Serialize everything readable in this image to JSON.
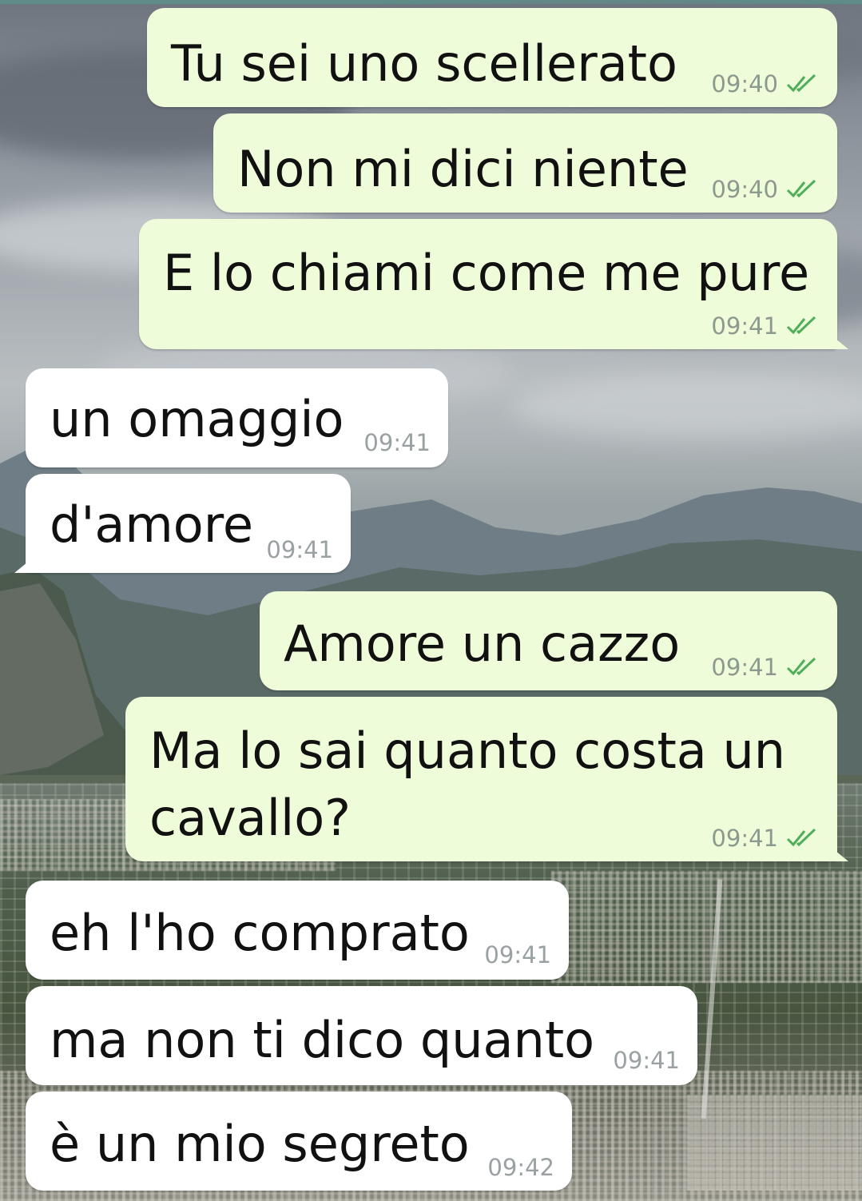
{
  "colors": {
    "outgoing_bubble": "#effcd9",
    "incoming_bubble": "#ffffff",
    "read_ticks": "#4fae5a",
    "timestamp": "#8b9a8f"
  },
  "messages": [
    {
      "direction": "outgoing",
      "text": "Tu sei uno scellerato",
      "time": "09:40",
      "status_icon": "double-check-icon"
    },
    {
      "direction": "outgoing",
      "text": "Non mi dici niente",
      "time": "09:40",
      "status_icon": "double-check-icon"
    },
    {
      "direction": "outgoing",
      "text": "E lo chiami come me pure",
      "time": "09:41",
      "status_icon": "double-check-icon"
    },
    {
      "direction": "incoming",
      "text": "un omaggio",
      "time": "09:41"
    },
    {
      "direction": "incoming",
      "text": "d'amore",
      "time": "09:41"
    },
    {
      "direction": "outgoing",
      "text": "Amore un cazzo",
      "time": "09:41",
      "status_icon": "double-check-icon"
    },
    {
      "direction": "outgoing",
      "text": "Ma lo sai quanto costa un",
      "text_line2": "cavallo?",
      "time": "09:41",
      "status_icon": "double-check-icon"
    },
    {
      "direction": "incoming",
      "text": "eh l'ho comprato",
      "time": "09:41"
    },
    {
      "direction": "incoming",
      "text": "ma non ti dico quanto",
      "time": "09:41"
    },
    {
      "direction": "incoming",
      "text": "è un mio segreto",
      "time": "09:42"
    }
  ]
}
